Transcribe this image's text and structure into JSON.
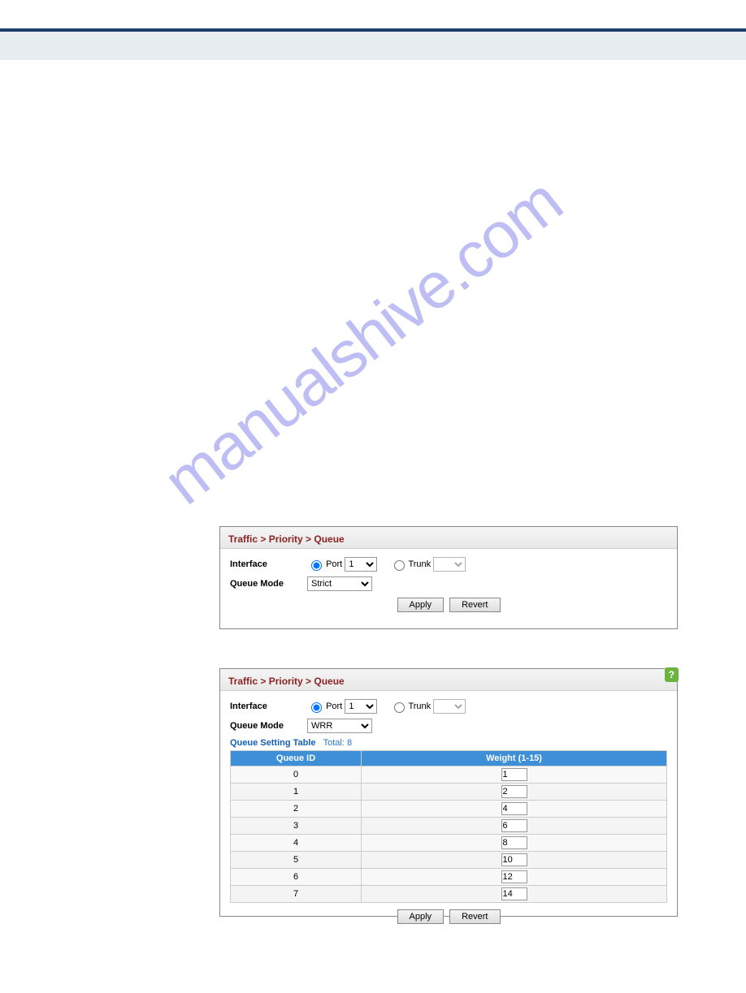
{
  "watermark": "manualshive.com",
  "panel1": {
    "breadcrumb": "Traffic > Priority > Queue",
    "interface_label": "Interface",
    "port_label": "Port",
    "port_value": "1",
    "trunk_label": "Trunk",
    "trunk_value": "",
    "queue_mode_label": "Queue Mode",
    "queue_mode_value": "Strict",
    "apply": "Apply",
    "revert": "Revert"
  },
  "panel2": {
    "breadcrumb": "Traffic > Priority > Queue",
    "help": "?",
    "interface_label": "Interface",
    "port_label": "Port",
    "port_value": "1",
    "trunk_label": "Trunk",
    "trunk_value": "",
    "queue_mode_label": "Queue Mode",
    "queue_mode_value": "WRR",
    "table_title": "Queue Setting Table",
    "total_label": "Total:",
    "total_value": "8",
    "columns": {
      "queue_id": "Queue ID",
      "weight": "Weight (1-15)"
    },
    "rows": [
      {
        "id": "0",
        "weight": "1"
      },
      {
        "id": "1",
        "weight": "2"
      },
      {
        "id": "2",
        "weight": "4"
      },
      {
        "id": "3",
        "weight": "6"
      },
      {
        "id": "4",
        "weight": "8"
      },
      {
        "id": "5",
        "weight": "10"
      },
      {
        "id": "6",
        "weight": "12"
      },
      {
        "id": "7",
        "weight": "14"
      }
    ],
    "apply": "Apply",
    "revert": "Revert"
  }
}
